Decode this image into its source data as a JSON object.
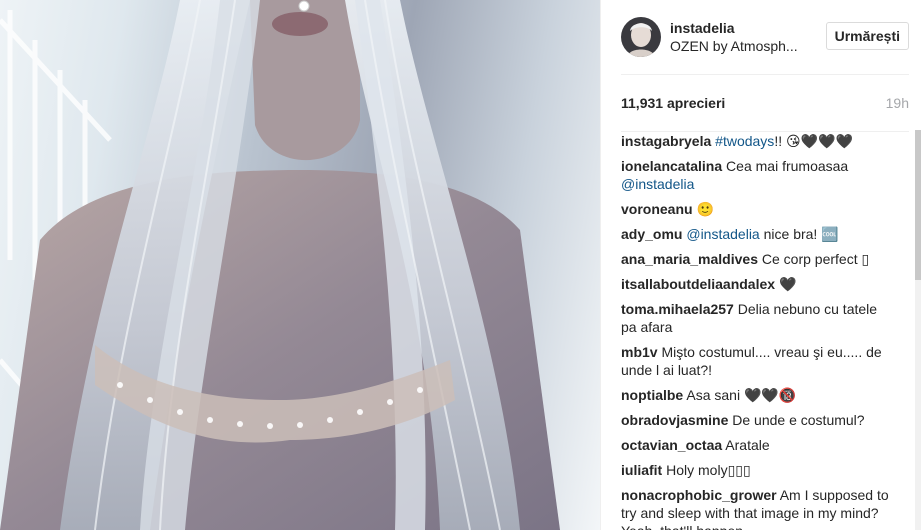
{
  "post": {
    "header": {
      "username": "instadelia",
      "location": "OZEN by Atmosph...",
      "follow_label": "Urmărești"
    },
    "stats": {
      "likes": "11,931 aprecieri",
      "time": "19h"
    },
    "comments": [
      {
        "author": "instagabryela",
        "hashtag": "#twodays",
        "text": "!! 😘🖤🖤🖤"
      },
      {
        "author": "ionelancatalina",
        "text": "Cea mai frumoasaa",
        "mention": "@instadelia"
      },
      {
        "author": "voroneanu",
        "text": "🙂"
      },
      {
        "author": "ady_omu",
        "mention": "@instadelia",
        "text": "nice bra! 🆒"
      },
      {
        "author": "ana_maria_maldives",
        "text": "Ce corp perfect ▯"
      },
      {
        "author": "itsallaboutdeliaandalex",
        "text": "🖤"
      },
      {
        "author": "toma.mihaela257",
        "text": "Delia nebuno cu tatele pa afara"
      },
      {
        "author": "mb1v",
        "text": "Mişto costumul.... vreau şi eu..... de unde l ai luat?!"
      },
      {
        "author": "noptialbe",
        "text": "Asa sani 🖤🖤🔞"
      },
      {
        "author": "obradovjasmine",
        "text": "De unde e costumul?"
      },
      {
        "author": "octavian_octaa",
        "text": "Aratale"
      },
      {
        "author": "iuliafit",
        "text": "Holy moly▯▯▯"
      },
      {
        "author": "nonacrophobic_grower",
        "text": "Am I supposed to try and sleep with that image in my mind? Yeah, that'll happen"
      }
    ]
  },
  "colors": {
    "link": "#125688",
    "muted": "#a5a7aa",
    "border": "#efefef"
  }
}
